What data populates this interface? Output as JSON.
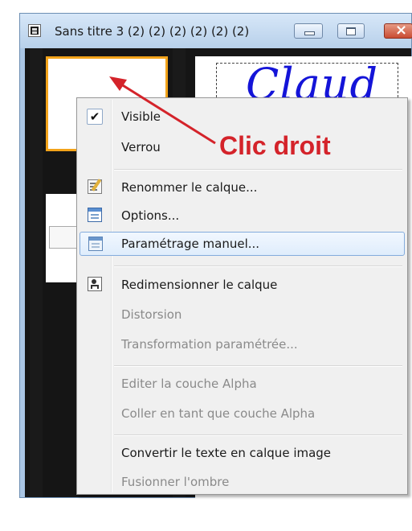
{
  "window": {
    "title": "Sans titre 3 (2) (2) (2) (2) (2) (2)",
    "icon": "document-window-icon"
  },
  "canvas": {
    "text": "Claud"
  },
  "layer_panel": {
    "partial_label": "S"
  },
  "annotation": {
    "label": "Clic droit",
    "color": "#d4232a"
  },
  "context_menu": {
    "items": [
      {
        "label": "Visible",
        "checked": true,
        "enabled": true
      },
      {
        "label": "Verrou",
        "enabled": true
      },
      {
        "label": "Renommer le calque...",
        "icon": "rename-icon",
        "enabled": true
      },
      {
        "label": "Options...",
        "icon": "options-icon",
        "enabled": true
      },
      {
        "label": "Paramétrage manuel...",
        "icon": "manual-settings-icon",
        "enabled": true,
        "highlighted": true
      },
      {
        "label": "Redimensionner le calque",
        "icon": "resize-layer-icon",
        "enabled": true
      },
      {
        "label": "Distorsion",
        "enabled": false
      },
      {
        "label": "Transformation paramétrée...",
        "enabled": false
      },
      {
        "label": "Editer la couche Alpha",
        "enabled": false
      },
      {
        "label": "Coller en tant que couche Alpha",
        "enabled": false
      },
      {
        "label": "Convertir le texte en calque image",
        "enabled": true
      },
      {
        "label": "Fusionner l'ombre",
        "enabled": false
      }
    ]
  },
  "colors": {
    "highlight_border": "#84acdd",
    "thumb_border": "#f2a31a",
    "canvas_text": "#1414d8"
  }
}
